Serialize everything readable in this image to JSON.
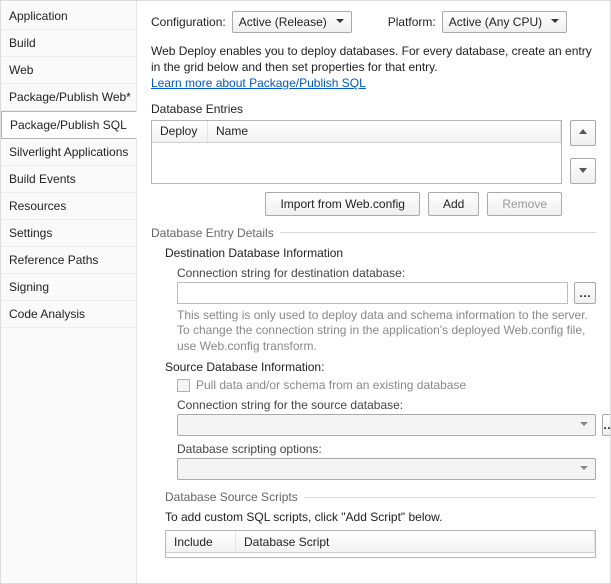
{
  "sidebar": {
    "items": [
      {
        "label": "Application"
      },
      {
        "label": "Build"
      },
      {
        "label": "Web"
      },
      {
        "label": "Package/Publish Web*"
      },
      {
        "label": "Package/Publish SQL",
        "selected": true
      },
      {
        "label": "Silverlight Applications"
      },
      {
        "label": "Build Events"
      },
      {
        "label": "Resources"
      },
      {
        "label": "Settings"
      },
      {
        "label": "Reference Paths"
      },
      {
        "label": "Signing"
      },
      {
        "label": "Code Analysis"
      }
    ]
  },
  "config": {
    "configuration_label": "Configuration:",
    "configuration_value": "Active (Release)",
    "platform_label": "Platform:",
    "platform_value": "Active (Any CPU)"
  },
  "description": {
    "text": "Web Deploy enables you to deploy databases. For every database, create an entry in the grid below and then set properties for that entry.",
    "link": "Learn more about Package/Publish SQL"
  },
  "entries": {
    "label": "Database Entries",
    "columns": {
      "deploy": "Deploy",
      "name": "Name"
    },
    "buttons": {
      "import": "Import from Web.config",
      "add": "Add",
      "remove": "Remove"
    }
  },
  "details": {
    "group_label": "Database Entry Details",
    "dest": {
      "title": "Destination Database Information",
      "conn_label": "Connection string for destination database:",
      "conn_value": "",
      "hint": "This setting is only used to deploy data and schema information to the server. To change the connection string in the application's deployed Web.config file, use Web.config transform."
    },
    "source": {
      "title": "Source Database Information:",
      "pull_label": "Pull data and/or schema from an existing database",
      "conn_label": "Connection string for the source database:",
      "conn_value": "",
      "script_opts_label": "Database scripting options:",
      "script_opts_value": ""
    },
    "scripts": {
      "group_label": "Database Source Scripts",
      "desc": "To add custom SQL scripts, click \"Add Script\" below.",
      "columns": {
        "include": "Include",
        "script": "Database Script"
      }
    }
  }
}
